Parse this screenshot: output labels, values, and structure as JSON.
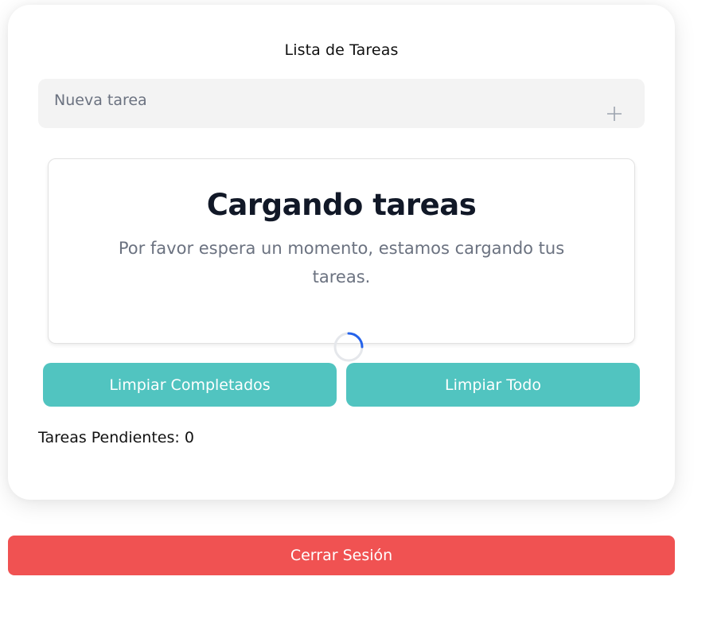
{
  "todo_card": {
    "title": "Lista de Tareas",
    "new_task": {
      "value": "",
      "placeholder": "Nueva tarea",
      "add_icon": "plus-icon"
    },
    "loading": {
      "heading": "Cargando tareas",
      "message": "Por favor espera un momento, estamos cargando tus tareas.",
      "spinner_icon": "loading-spinner-icon"
    },
    "actions": {
      "clear_completed_label": "Limpiar Completados",
      "clear_all_label": "Limpiar Todo"
    },
    "pending": {
      "label": "Tareas Pendientes: 0",
      "count": 0
    }
  },
  "logout": {
    "label": "Cerrar Sesión"
  },
  "colors": {
    "accent": "#51c4c0",
    "danger": "#f05252",
    "spinner": "#2563eb",
    "input_background": "#f3f3f3",
    "heading_text": "#111827",
    "muted_text": "#6b7280"
  }
}
